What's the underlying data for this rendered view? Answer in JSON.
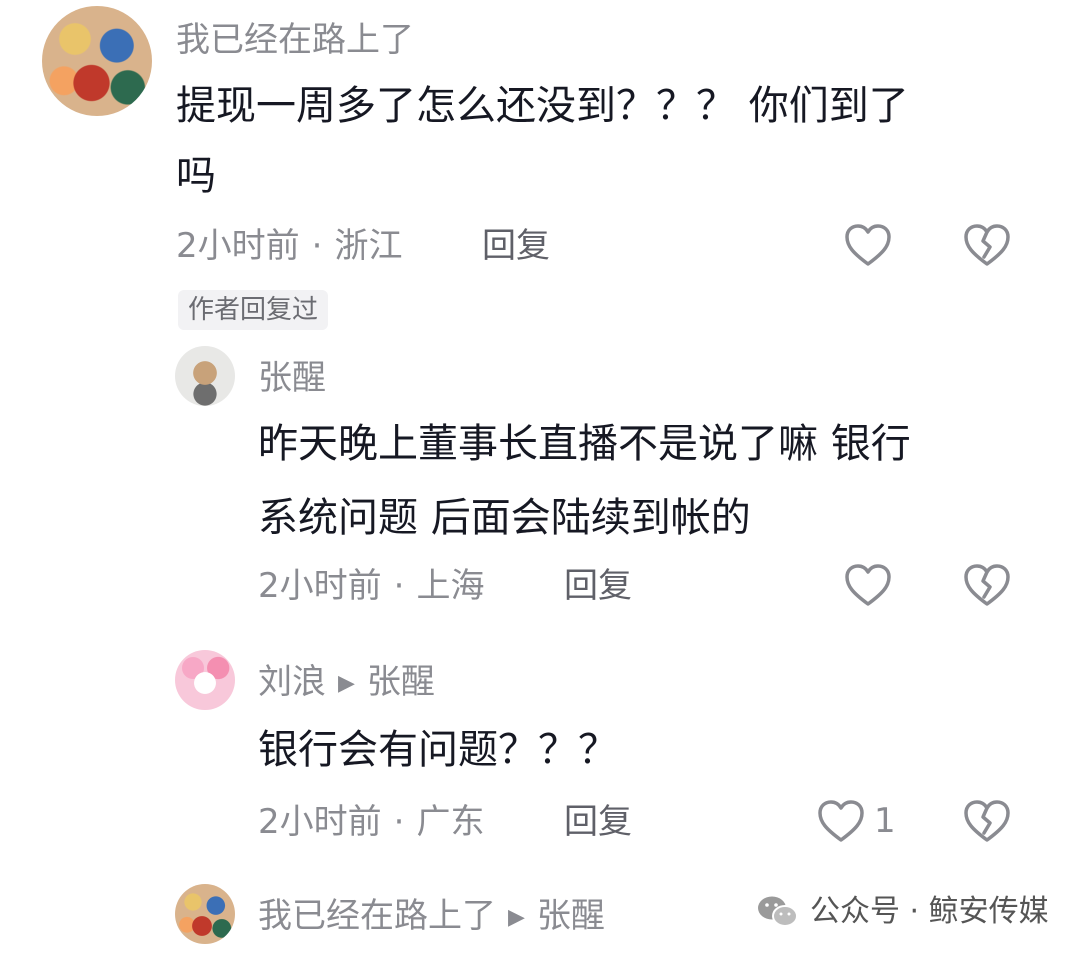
{
  "comments": [
    {
      "username": "我已经在路上了",
      "content_lines": [
        "提现一周多了怎么还没到？？？ 你们到了",
        "吗"
      ],
      "time": "2小时前",
      "location": "浙江",
      "reply_label": "回复",
      "author_replied_badge": "作者回复过",
      "avatar_icon": "comic-avatar-icon"
    },
    {
      "username": "张醒",
      "content_lines": [
        "昨天晚上董事长直播不是说了嘛 银行",
        "系统问题 后面会陆续到帐的"
      ],
      "time": "2小时前",
      "location": "上海",
      "reply_label": "回复",
      "avatar_icon": "dog-avatar-icon"
    },
    {
      "username": "刘浪",
      "reply_to": "张醒",
      "content_lines": [
        "银行会有问题？？？"
      ],
      "time": "2小时前",
      "location": "广东",
      "reply_label": "回复",
      "like_count": "1",
      "avatar_icon": "pink-avatar-icon"
    },
    {
      "username": "我已经在路上了",
      "reply_to": "张醒",
      "avatar_icon": "comic-avatar-icon"
    }
  ],
  "meta_separator": "·",
  "reply_arrow": "▶",
  "watermark": {
    "text": "公众号 · 鲸安传媒",
    "icon": "wechat-icon"
  },
  "colors": {
    "text": "#161823",
    "secondary": "#8a8b91",
    "badge_bg": "#f2f2f4"
  }
}
